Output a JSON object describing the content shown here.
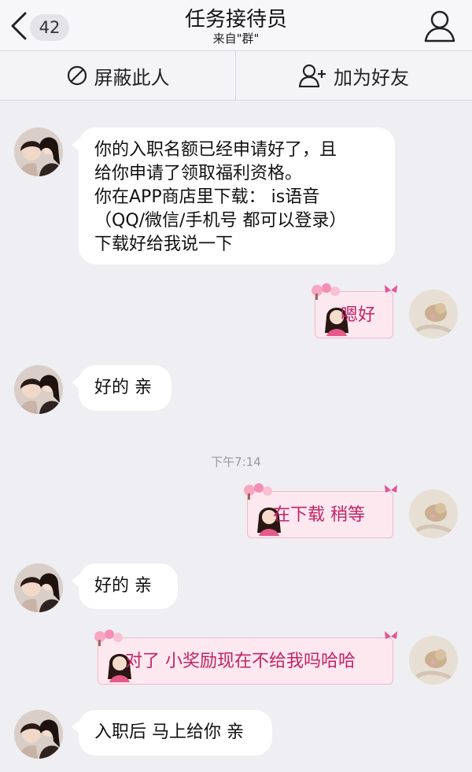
{
  "header": {
    "unread_count": "42",
    "title": "任务接待员",
    "subtitle": "来自\"群\""
  },
  "actions": {
    "block_label": "屏蔽此人",
    "add_friend_label": "加为好友"
  },
  "messages": [
    {
      "side": "left",
      "text": "你的入职名额已经申请好了，且\n给你申请了领取福利资格。\n你在APP商店里下载： is语音\n（QQ/微信/手机号  都可以登录）\n下载好给我说一下"
    },
    {
      "side": "right",
      "text": "嗯好"
    },
    {
      "side": "left",
      "text": "好的 亲"
    },
    {
      "side": "right",
      "text": "在下载  稍等"
    },
    {
      "side": "left",
      "text": "好的  亲"
    },
    {
      "side": "right",
      "text": "对了 小奖励现在不给我吗哈哈"
    },
    {
      "side": "left",
      "text": "入职后 马上给你 亲"
    }
  ],
  "timestamp": "下午7:14",
  "colors": {
    "chat_bg": "#efeef3",
    "bubble_left": "#ffffff",
    "bubble_right": "#fde8ef",
    "bubble_right_text": "#c42266"
  }
}
